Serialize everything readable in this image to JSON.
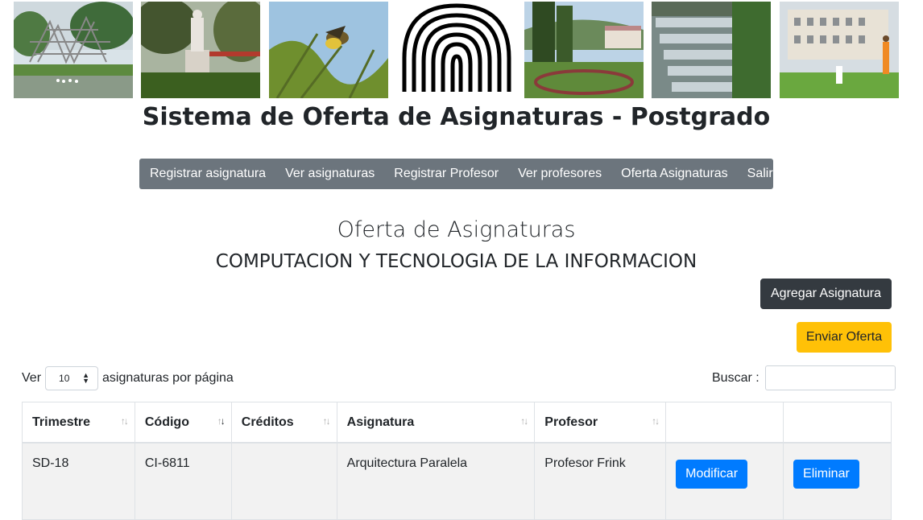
{
  "header": {
    "title": "Sistema de Oferta de Asignaturas - Postgrado"
  },
  "nav": {
    "items": [
      "Registrar asignatura",
      "Ver asignaturas",
      "Registrar Profesor",
      "Ver profesores",
      "Oferta Asignaturas",
      "Salir"
    ]
  },
  "page": {
    "heading": "Oferta de Asignaturas",
    "department": "COMPUTACION Y TECNOLOGIA DE LA INFORMACION",
    "add_button": "Agregar Asignatura",
    "send_button": "Enviar Oferta"
  },
  "table_controls": {
    "show_label": "Ver",
    "page_size": "10",
    "per_page_label": "asignaturas por página",
    "search_label": "Buscar :"
  },
  "table": {
    "columns": [
      "Trimestre",
      "Código",
      "Créditos",
      "Asignatura",
      "Profesor",
      "",
      ""
    ],
    "rows": [
      {
        "trimestre": "SD-18",
        "codigo": "CI-6811",
        "creditos": "",
        "asignatura": "Arquitectura Paralela",
        "profesor": "Profesor Frink",
        "edit_label": "Modificar",
        "delete_label": "Eliminar"
      }
    ]
  },
  "colors": {
    "navbar": "#6c757d",
    "primary": "#007bff",
    "dark": "#343a40",
    "warning": "#ffc107"
  }
}
